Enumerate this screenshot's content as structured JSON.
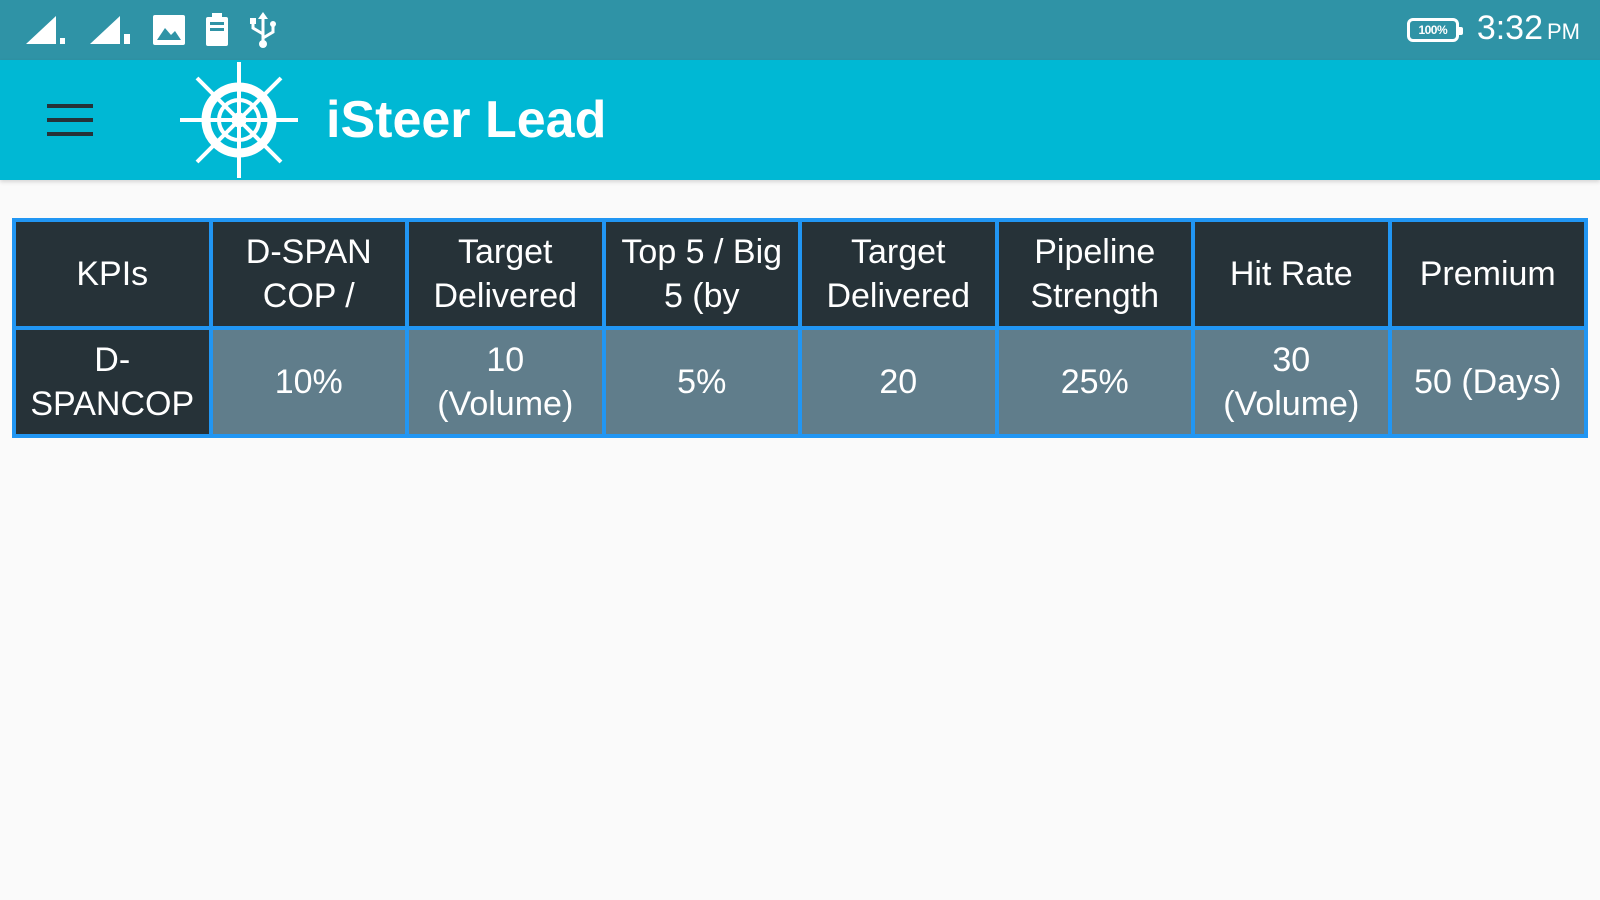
{
  "status_bar": {
    "icons": [
      "signal-1-icon",
      "signal-2-icon",
      "gallery-icon",
      "battery-saver-icon",
      "usb-icon"
    ],
    "battery_label": "100%",
    "time": "3:32",
    "ampm": "PM"
  },
  "app_bar": {
    "title": "iSteer Lead",
    "menu_icon": "hamburger-menu-icon",
    "logo_icon": "ship-wheel-icon"
  },
  "table": {
    "headers": [
      "KPIs",
      "D-SPAN COP /",
      "Target Delivered",
      "Top 5 / Big 5 (by",
      "Target Delivered",
      "Pipeline Strength",
      "Hit Rate",
      "Premium"
    ],
    "rows": [
      [
        "D-SPANCOP",
        "10%",
        "10 (Volume)",
        "5%",
        "20",
        "25%",
        "30 (Volume)",
        "50 (Days)"
      ]
    ]
  },
  "colors": {
    "status_bar": "#2f93a6",
    "app_bar": "#00b8d4",
    "header_cell": "#263238",
    "value_cell": "#607d8b",
    "cell_border": "#2196f3",
    "background": "#fafafa"
  }
}
